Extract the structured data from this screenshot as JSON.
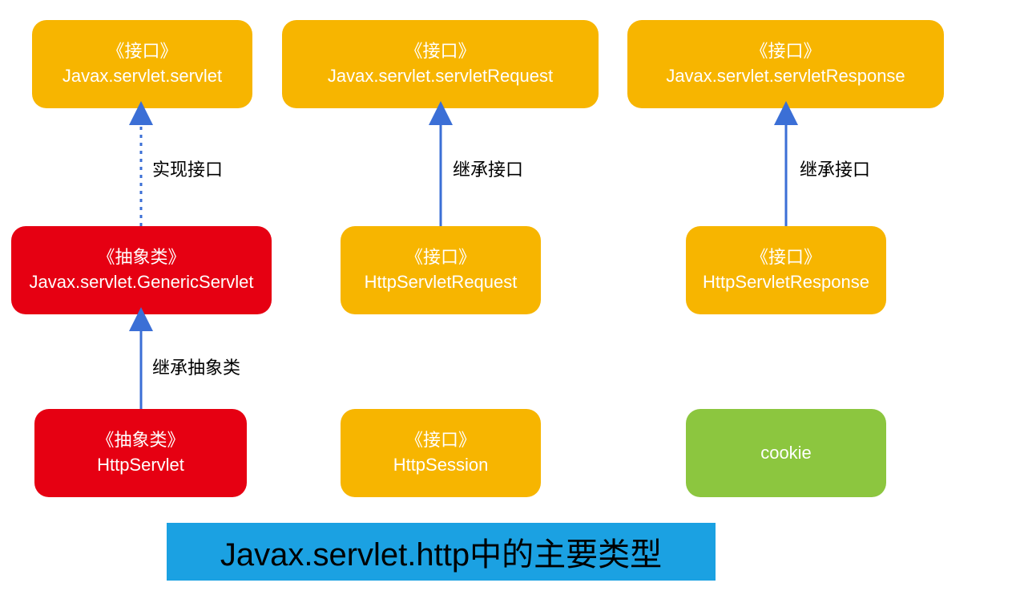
{
  "titleBar": "Javax.servlet.http中的主要类型",
  "boxes": {
    "topLeft": {
      "stereotype": "《接口》",
      "name": "Javax.servlet.servlet"
    },
    "topMid": {
      "stereotype": "《接口》",
      "name": "Javax.servlet.servletRequest"
    },
    "topRight": {
      "stereotype": "《接口》",
      "name": "Javax.servlet.servletResponse"
    },
    "midLeft": {
      "stereotype": "《抽象类》",
      "name": "Javax.servlet.GenericServlet"
    },
    "midMid": {
      "stereotype": "《接口》",
      "name": "HttpServletRequest"
    },
    "midRight": {
      "stereotype": "《接口》",
      "name": "HttpServletResponse"
    },
    "botLeft": {
      "stereotype": "《抽象类》",
      "name": "HttpServlet"
    },
    "botMid": {
      "stereotype": "《接口》",
      "name": "HttpSession"
    },
    "botRight": {
      "single": "cookie"
    }
  },
  "labels": {
    "l1": "实现接口",
    "l2": "继承接口",
    "l3": "继承接口",
    "l4": "继承抽象类"
  }
}
